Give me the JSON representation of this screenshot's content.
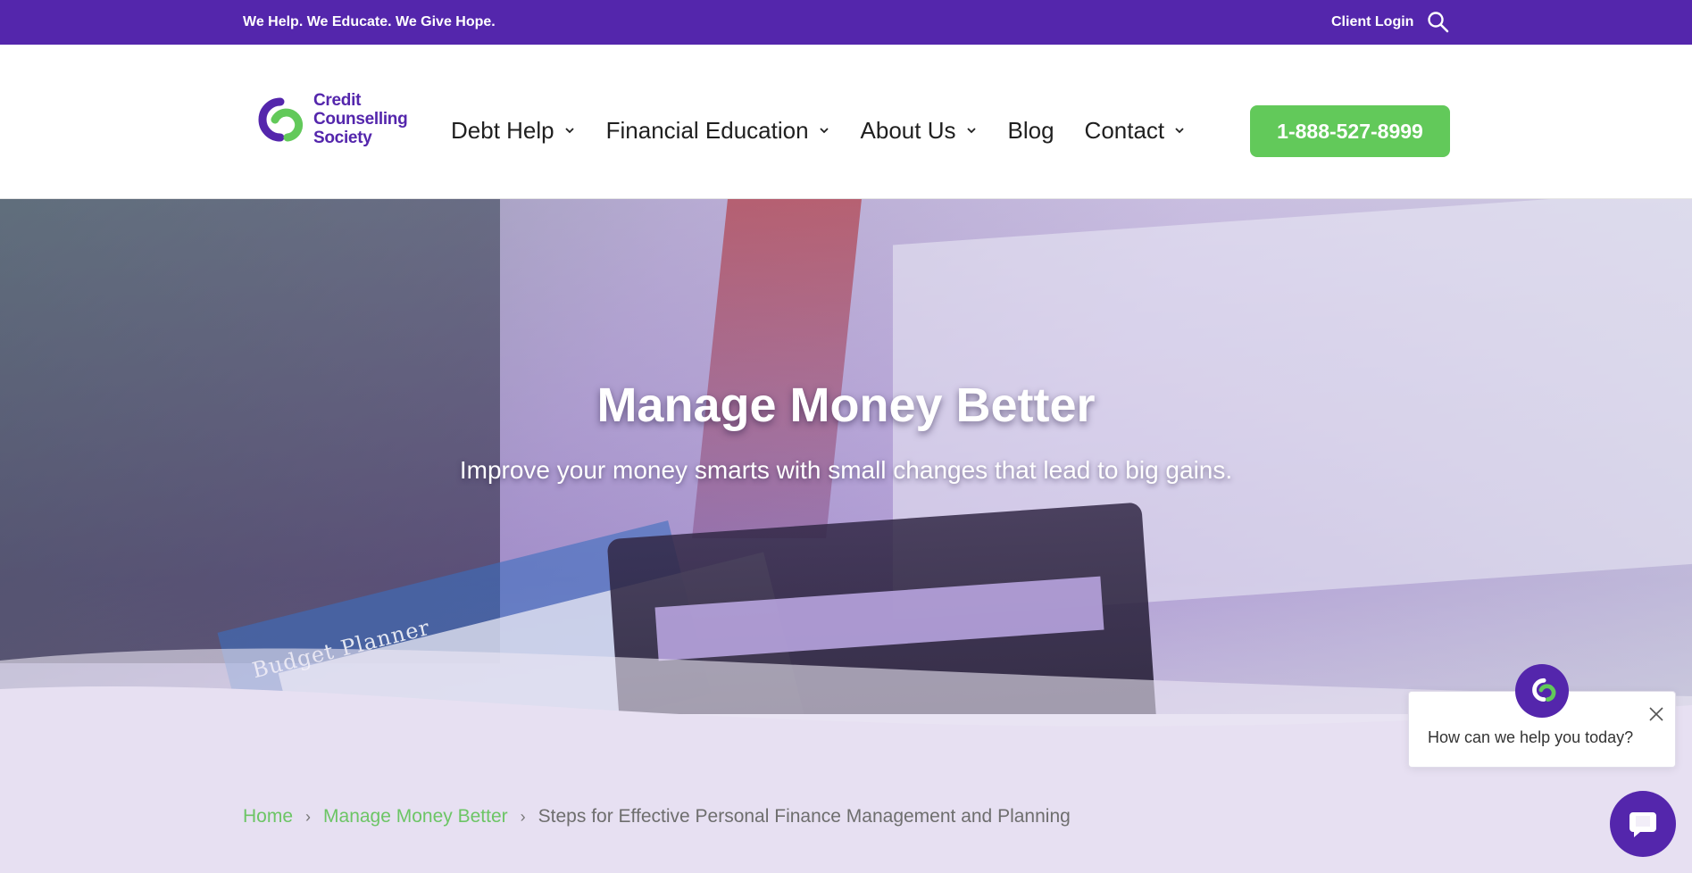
{
  "topbar": {
    "tagline": "We Help. We Educate. We Give Hope.",
    "client_login": "Client Login",
    "search_icon": "search-icon"
  },
  "header": {
    "logo_lines": [
      "Credit",
      "Counselling",
      "Society"
    ],
    "nav": [
      {
        "label": "Debt Help",
        "has_dropdown": true
      },
      {
        "label": "Financial Education",
        "has_dropdown": true
      },
      {
        "label": "About Us",
        "has_dropdown": true
      },
      {
        "label": "Blog",
        "has_dropdown": false
      },
      {
        "label": "Contact",
        "has_dropdown": true
      }
    ],
    "phone": "1-888-527-8999"
  },
  "hero": {
    "title": "Manage Money Better",
    "subtitle": "Improve your money smarts with small changes that lead to big gains.",
    "image_text": "Budget Planner"
  },
  "breadcrumb": {
    "home": "Home",
    "section": "Manage Money Better",
    "current": "Steps for Effective Personal Finance Management and Planning"
  },
  "chat": {
    "prompt": "How can we help you today?",
    "close_icon": "close-icon",
    "launcher_icon": "chat-bubble-icon"
  },
  "colors": {
    "brand_purple": "#5426ac",
    "brand_green": "#62c95a",
    "breadcrumb_bg": "#e7e0f2"
  }
}
